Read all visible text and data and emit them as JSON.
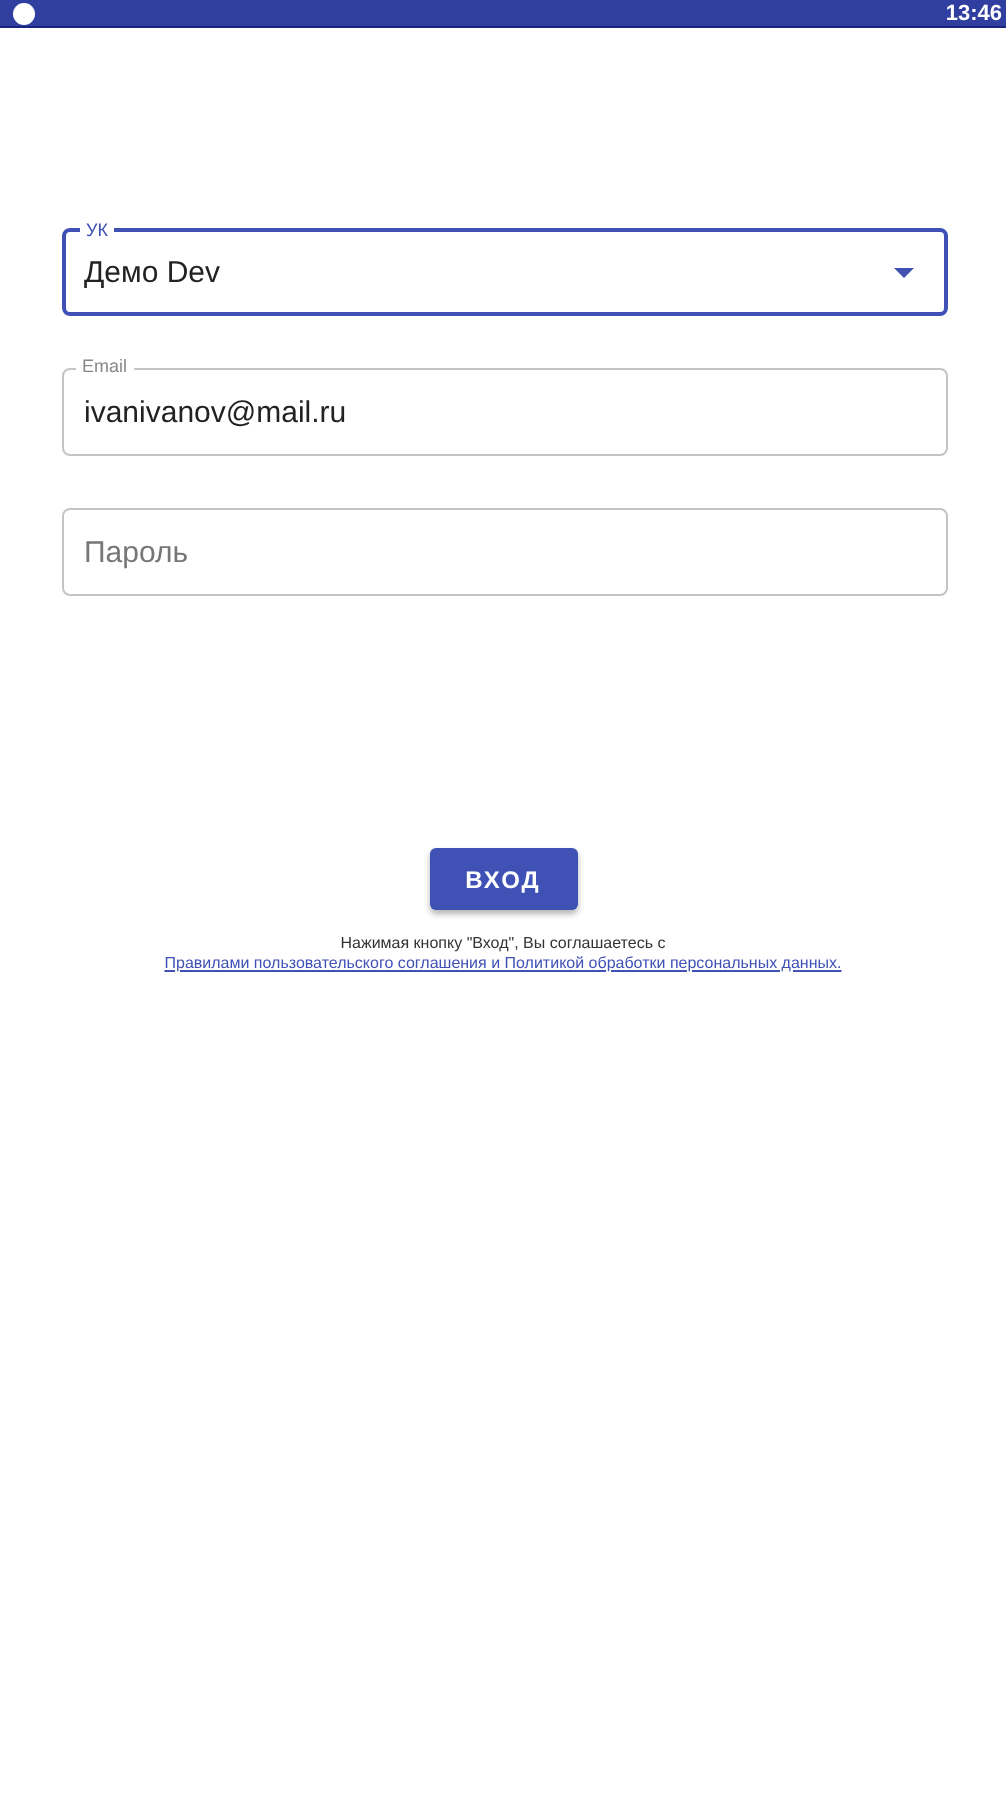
{
  "status_bar": {
    "time": "13:46"
  },
  "fields": [
    {
      "kind": "select",
      "label": "УК",
      "value": "Демо Dev",
      "focused": true
    },
    {
      "kind": "text",
      "label": "Email",
      "value": "ivanivanov@mail.ru",
      "focused": false
    },
    {
      "kind": "password",
      "placeholder": "Пароль",
      "focused": false
    }
  ],
  "login_button": "ВХОД",
  "consent": {
    "text": "Нажимая кнопку \"Вход\", Вы соглашаетесь с ",
    "link": "Правилами пользовательского соглашения и Политикой обработки персональных данных."
  }
}
